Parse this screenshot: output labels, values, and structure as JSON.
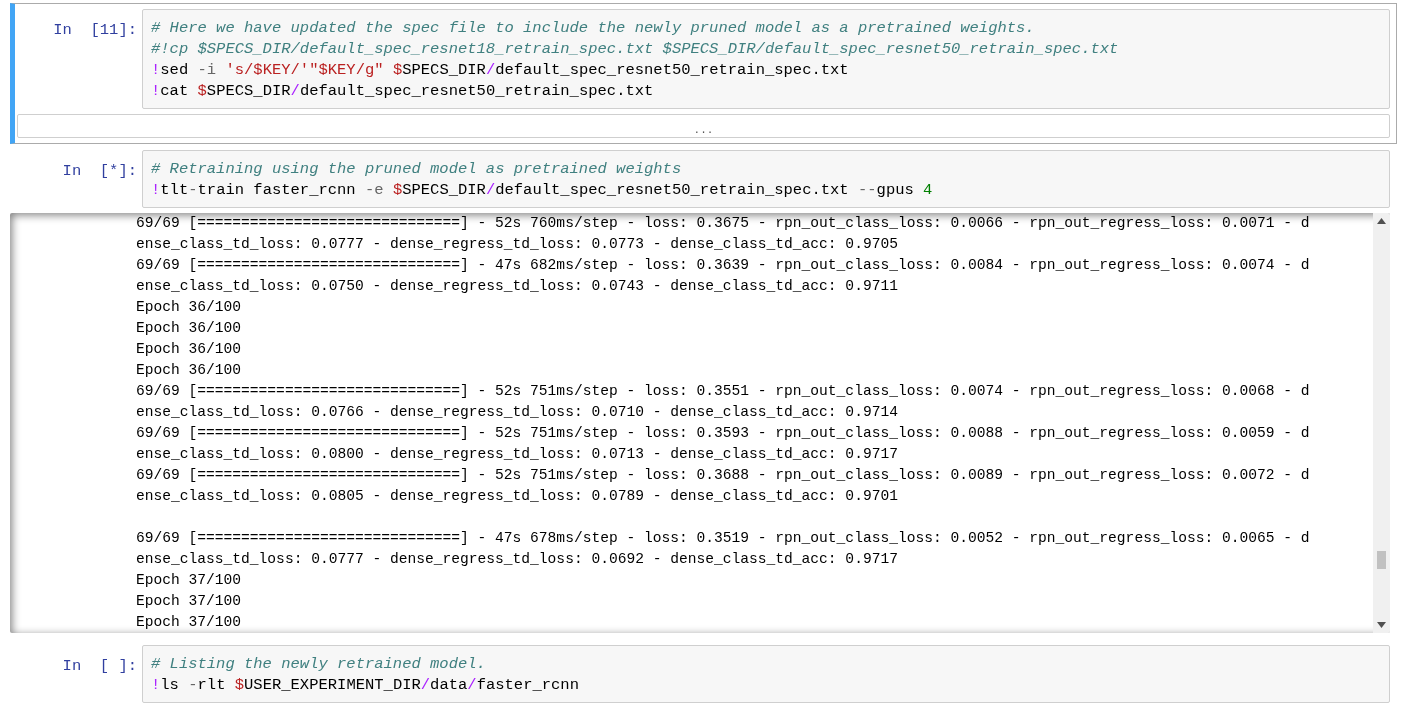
{
  "cells": [
    {
      "prompt": "In  [11]:",
      "selected": true,
      "input": [
        [
          {
            "kind": "comment",
            "text": "# Here we have updated the spec file to include the newly pruned model as a pretrained weights."
          }
        ],
        [
          {
            "kind": "comment",
            "text": "#!cp $SPECS_DIR/default_spec_resnet18_retrain_spec.txt $SPECS_DIR/default_spec_resnet50_retrain_spec.txt"
          }
        ],
        [
          {
            "kind": "bang",
            "text": "!"
          },
          {
            "kind": "plain",
            "text": "sed "
          },
          {
            "kind": "option",
            "text": "-i "
          },
          {
            "kind": "string",
            "text": "'s/$KEY/'\"$KEY/g\" "
          },
          {
            "kind": "dollar",
            "text": "$"
          },
          {
            "kind": "plain",
            "text": "SPECS_DIR"
          },
          {
            "kind": "slash",
            "text": "/"
          },
          {
            "kind": "plain",
            "text": "default_spec_resnet50_retrain_spec.txt"
          }
        ],
        [
          {
            "kind": "bang",
            "text": "!"
          },
          {
            "kind": "plain",
            "text": "cat "
          },
          {
            "kind": "dollar",
            "text": "$"
          },
          {
            "kind": "plain",
            "text": "SPECS_DIR"
          },
          {
            "kind": "slash",
            "text": "/"
          },
          {
            "kind": "plain",
            "text": "default_spec_resnet50_retrain_spec.txt"
          }
        ]
      ],
      "output": {
        "kind": "collapsed",
        "label": "..."
      }
    },
    {
      "prompt": "In  [*]:",
      "selected": false,
      "input": [
        [
          {
            "kind": "comment",
            "text": "# Retraining using the pruned model as pretrained weights"
          }
        ],
        [
          {
            "kind": "bang",
            "text": "!"
          },
          {
            "kind": "plain",
            "text": "tlt"
          },
          {
            "kind": "option",
            "text": "-"
          },
          {
            "kind": "plain",
            "text": "train faster_rcnn "
          },
          {
            "kind": "option",
            "text": "-e "
          },
          {
            "kind": "dollar",
            "text": "$"
          },
          {
            "kind": "plain",
            "text": "SPECS_DIR"
          },
          {
            "kind": "slash",
            "text": "/"
          },
          {
            "kind": "plain",
            "text": "default_spec_resnet50_retrain_spec.txt "
          },
          {
            "kind": "option",
            "text": "--"
          },
          {
            "kind": "plain",
            "text": "gpus "
          },
          {
            "kind": "number",
            "text": "4"
          }
        ]
      ],
      "output": {
        "kind": "scrolled",
        "lines": [
          {
            "text": "69/69 [==============================] - 52s 760ms/step - loss: 0.3675 - rpn_out_class_loss: 0.0066 - rpn_out_regress_loss: 0.0071 - d",
            "space_before": false
          },
          {
            "text": "ense_class_td_loss: 0.0777 - dense_regress_td_loss: 0.0773 - dense_class_td_acc: 0.9705",
            "space_before": false
          },
          {
            "text": "69/69 [==============================] - 47s 682ms/step - loss: 0.3639 - rpn_out_class_loss: 0.0084 - rpn_out_regress_loss: 0.0074 - d",
            "space_before": false
          },
          {
            "text": "ense_class_td_loss: 0.0750 - dense_regress_td_loss: 0.0743 - dense_class_td_acc: 0.9711",
            "space_before": false
          },
          {
            "text": "Epoch 36/100",
            "space_before": false
          },
          {
            "text": "Epoch 36/100",
            "space_before": false
          },
          {
            "text": "Epoch 36/100",
            "space_before": false
          },
          {
            "text": "Epoch 36/100",
            "space_before": false
          },
          {
            "text": "69/69 [==============================] - 52s 751ms/step - loss: 0.3551 - rpn_out_class_loss: 0.0074 - rpn_out_regress_loss: 0.0068 - d",
            "space_before": false
          },
          {
            "text": "ense_class_td_loss: 0.0766 - dense_regress_td_loss: 0.0710 - dense_class_td_acc: 0.9714",
            "space_before": false
          },
          {
            "text": "69/69 [==============================] - 52s 751ms/step - loss: 0.3593 - rpn_out_class_loss: 0.0088 - rpn_out_regress_loss: 0.0059 - d",
            "space_before": false
          },
          {
            "text": "ense_class_td_loss: 0.0800 - dense_regress_td_loss: 0.0713 - dense_class_td_acc: 0.9717",
            "space_before": false
          },
          {
            "text": "69/69 [==============================] - 52s 751ms/step - loss: 0.3688 - rpn_out_class_loss: 0.0089 - rpn_out_regress_loss: 0.0072 - d",
            "space_before": false
          },
          {
            "text": "ense_class_td_loss: 0.0805 - dense_regress_td_loss: 0.0789 - dense_class_td_acc: 0.9701",
            "space_before": false
          },
          {
            "text": "69/69 [==============================] - 47s 678ms/step - loss: 0.3519 - rpn_out_class_loss: 0.0052 - rpn_out_regress_loss: 0.0065 - d",
            "space_before": true
          },
          {
            "text": "ense_class_td_loss: 0.0777 - dense_regress_td_loss: 0.0692 - dense_class_td_acc: 0.9717",
            "space_before": false
          },
          {
            "text": "Epoch 37/100",
            "space_before": false
          },
          {
            "text": "Epoch 37/100",
            "space_before": false
          },
          {
            "text": "Epoch 37/100",
            "space_before": false
          }
        ]
      }
    },
    {
      "prompt": "In  [ ]:",
      "selected": false,
      "input": [
        [
          {
            "kind": "comment",
            "text": "# Listing the newly retrained model."
          }
        ],
        [
          {
            "kind": "bang",
            "text": "!"
          },
          {
            "kind": "plain",
            "text": "ls "
          },
          {
            "kind": "option",
            "text": "-"
          },
          {
            "kind": "plain",
            "text": "rlt "
          },
          {
            "kind": "dollar",
            "text": "$"
          },
          {
            "kind": "plain",
            "text": "USER_EXPERIMENT_DIR"
          },
          {
            "kind": "slash",
            "text": "/"
          },
          {
            "kind": "plain",
            "text": "data"
          },
          {
            "kind": "slash",
            "text": "/"
          },
          {
            "kind": "plain",
            "text": "faster_rcnn"
          }
        ]
      ]
    }
  ]
}
